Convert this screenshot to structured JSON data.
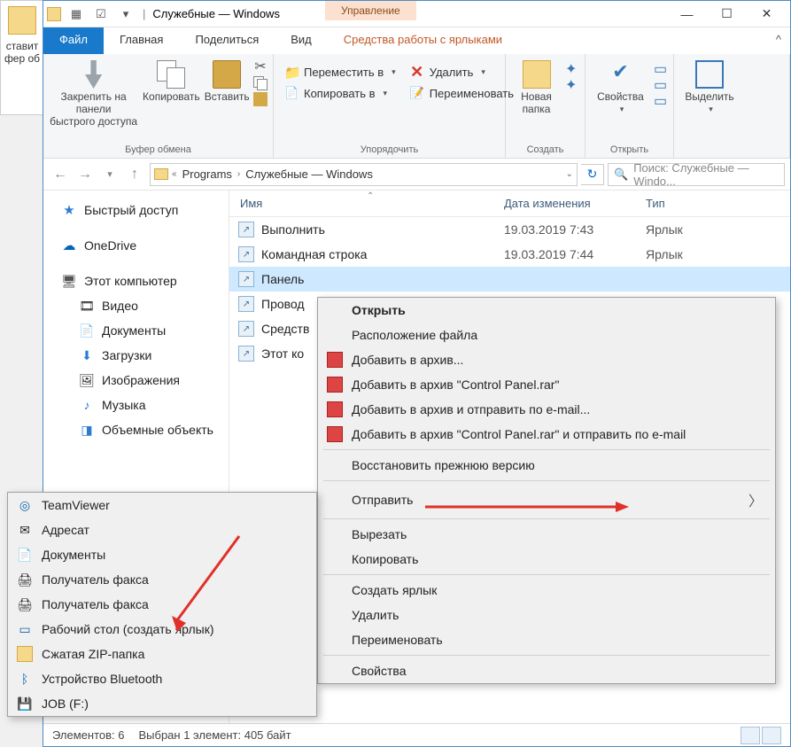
{
  "background": {
    "paste_label": "ставит",
    "clip_label": "фер об"
  },
  "titlebar": {
    "title": "Служебные — Windows",
    "manage_tab": "Управление"
  },
  "window_controls": {
    "min": "—",
    "max": "☐",
    "close": "✕"
  },
  "ribbon_tabs": {
    "file": "Файл",
    "home": "Главная",
    "share": "Поделиться",
    "view": "Вид",
    "shortcut_tools": "Средства работы с ярлыками"
  },
  "ribbon": {
    "pin": "Закрепить на панели\nбыстрого доступа",
    "copy": "Копировать",
    "paste": "Вставить",
    "clipboard_group": "Буфер обмена",
    "move_to": "Переместить в",
    "copy_to": "Копировать в",
    "delete": "Удалить",
    "rename": "Переименовать",
    "organize_group": "Упорядочить",
    "new_folder": "Новая\nпапка",
    "new_group": "Создать",
    "properties": "Свойства",
    "open_group": "Открыть",
    "select": "Выделить"
  },
  "address": {
    "seg1": "Programs",
    "seg2": "Служебные — Windows",
    "search_placeholder": "Поиск: Служебные — Windo..."
  },
  "nav_pane": {
    "quick": "Быстрый доступ",
    "onedrive": "OneDrive",
    "thispc": "Этот компьютер",
    "video": "Видео",
    "documents": "Документы",
    "downloads": "Загрузки",
    "pictures": "Изображения",
    "music": "Музыка",
    "objects3d": "Объемные объекть"
  },
  "columns": {
    "name": "Имя",
    "date": "Дата изменения",
    "type": "Тип"
  },
  "files": [
    {
      "name": "Выполнить",
      "date": "19.03.2019 7:43",
      "type": "Ярлык"
    },
    {
      "name": "Командная строка",
      "date": "19.03.2019 7:44",
      "type": "Ярлык"
    },
    {
      "name": "Панель",
      "date": "",
      "type": ""
    },
    {
      "name": "Провод",
      "date": "",
      "type": ""
    },
    {
      "name": "Средств",
      "date": "",
      "type": ""
    },
    {
      "name": "Этот ко",
      "date": "",
      "type": ""
    }
  ],
  "context_main": {
    "open": "Открыть",
    "file_location": "Расположение файла",
    "add_archive": "Добавить в архив...",
    "add_rar": "Добавить в архив \"Control Panel.rar\"",
    "add_email": "Добавить в архив и отправить по e-mail...",
    "add_rar_email": "Добавить в архив \"Control Panel.rar\" и отправить по e-mail",
    "restore": "Восстановить прежнюю версию",
    "send_to": "Отправить",
    "cut": "Вырезать",
    "copy": "Копировать",
    "create_shortcut": "Создать ярлык",
    "delete": "Удалить",
    "rename": "Переименовать",
    "properties": "Свойства"
  },
  "context_sub": {
    "teamviewer": "TeamViewer",
    "addressee": "Адресат",
    "documents": "Документы",
    "fax1": "Получатель факса",
    "fax2": "Получатель факса",
    "desktop": "Рабочий стол (создать ярлык)",
    "zip": "Сжатая ZIP-папка",
    "bluetooth": "Устройство Bluetooth",
    "job": "JOB (F:)"
  },
  "status": {
    "items": "Элементов: 6",
    "selected": "Выбран 1 элемент: 405 байт"
  }
}
